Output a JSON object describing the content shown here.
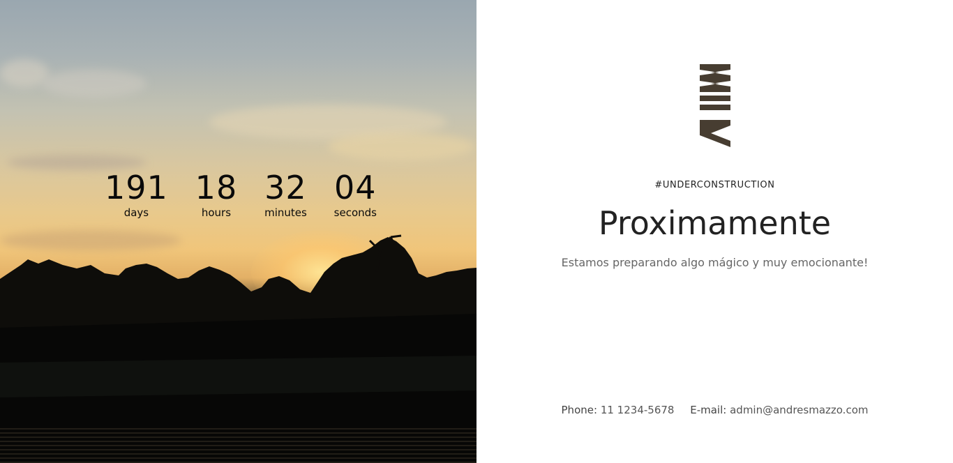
{
  "countdown": {
    "units": [
      {
        "value": "191",
        "label": "days"
      },
      {
        "value": "18",
        "label": "hours"
      },
      {
        "value": "32",
        "label": "minutes"
      },
      {
        "value": "04",
        "label": "seconds"
      }
    ]
  },
  "content": {
    "logo_icon": "mv-monogram-icon",
    "tag": "#UNDERCONSTRUCTION",
    "headline": "Proximamente",
    "subline": "Estamos preparando algo mágico y muy emocionante!"
  },
  "contact": {
    "phone_label": "Phone:",
    "phone_value": "11 1234-5678",
    "email_label": "E-mail:",
    "email_value": "admin@andresmazzo.com"
  },
  "colors": {
    "logo": "#473d31",
    "text_dark": "#222222",
    "text_muted": "#666666"
  }
}
